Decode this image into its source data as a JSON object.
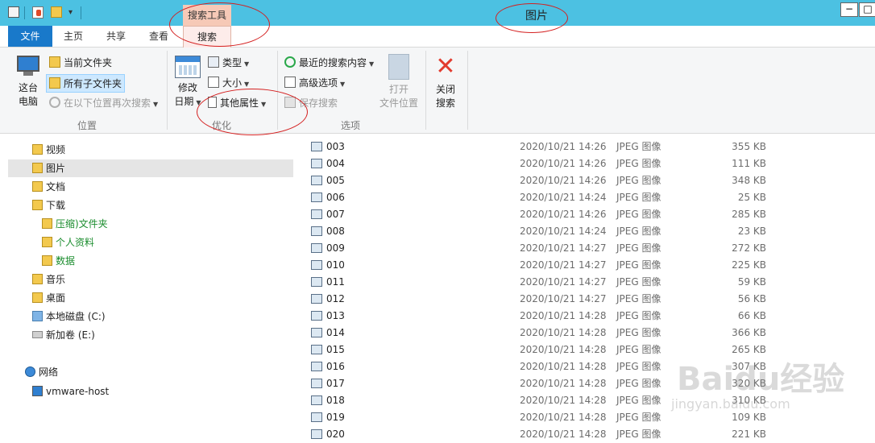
{
  "window": {
    "title": "图片",
    "minimize": "−",
    "maximize": "□"
  },
  "context_tab": {
    "header": "搜索工具",
    "tab": "搜索"
  },
  "tabs": [
    {
      "label": "文件"
    },
    {
      "label": "主页"
    },
    {
      "label": "共享"
    },
    {
      "label": "查看"
    }
  ],
  "ribbon": {
    "location": {
      "group_label": "位置",
      "this_pc_line1": "这台",
      "this_pc_line2": "电脑",
      "current_folder": "当前文件夹",
      "all_subfolders": "所有子文件夹",
      "search_again": "在以下位置再次搜索"
    },
    "refine": {
      "group_label": "优化",
      "date_modified_line1": "修改",
      "date_modified_line2": "日期",
      "kind": "类型",
      "size": "大小",
      "other_properties": "其他属性"
    },
    "options": {
      "group_label": "选项",
      "recent_searches": "最近的搜索内容",
      "advanced_options": "高级选项",
      "save_search": "保存搜索",
      "open_location_line1": "打开",
      "open_location_line2": "文件位置"
    },
    "close": {
      "line1": "关闭",
      "line2": "搜索"
    }
  },
  "nav": {
    "items": [
      {
        "label": "视频"
      },
      {
        "label": "图片"
      },
      {
        "label": "文档"
      },
      {
        "label": "下载"
      },
      {
        "label": "压缩)文件夹"
      },
      {
        "label": "个人资料"
      },
      {
        "label": "数据"
      },
      {
        "label": "音乐"
      },
      {
        "label": "桌面"
      },
      {
        "label": "本地磁盘 (C:)"
      },
      {
        "label": "新加卷 (E:)"
      },
      {
        "label": "网络"
      },
      {
        "label": "vmware-host"
      }
    ]
  },
  "files": [
    {
      "name": "003",
      "date": "2020/10/21 14:26",
      "type": "JPEG 图像",
      "size": "355 KB"
    },
    {
      "name": "004",
      "date": "2020/10/21 14:26",
      "type": "JPEG 图像",
      "size": "111 KB"
    },
    {
      "name": "005",
      "date": "2020/10/21 14:26",
      "type": "JPEG 图像",
      "size": "348 KB"
    },
    {
      "name": "006",
      "date": "2020/10/21 14:24",
      "type": "JPEG 图像",
      "size": "25 KB"
    },
    {
      "name": "007",
      "date": "2020/10/21 14:26",
      "type": "JPEG 图像",
      "size": "285 KB"
    },
    {
      "name": "008",
      "date": "2020/10/21 14:24",
      "type": "JPEG 图像",
      "size": "23 KB"
    },
    {
      "name": "009",
      "date": "2020/10/21 14:27",
      "type": "JPEG 图像",
      "size": "272 KB"
    },
    {
      "name": "010",
      "date": "2020/10/21 14:27",
      "type": "JPEG 图像",
      "size": "225 KB"
    },
    {
      "name": "011",
      "date": "2020/10/21 14:27",
      "type": "JPEG 图像",
      "size": "59 KB"
    },
    {
      "name": "012",
      "date": "2020/10/21 14:27",
      "type": "JPEG 图像",
      "size": "56 KB"
    },
    {
      "name": "013",
      "date": "2020/10/21 14:28",
      "type": "JPEG 图像",
      "size": "66 KB"
    },
    {
      "name": "014",
      "date": "2020/10/21 14:28",
      "type": "JPEG 图像",
      "size": "366 KB"
    },
    {
      "name": "015",
      "date": "2020/10/21 14:28",
      "type": "JPEG 图像",
      "size": "265 KB"
    },
    {
      "name": "016",
      "date": "2020/10/21 14:28",
      "type": "JPEG 图像",
      "size": "307 KB"
    },
    {
      "name": "017",
      "date": "2020/10/21 14:28",
      "type": "JPEG 图像",
      "size": "320 KB"
    },
    {
      "name": "018",
      "date": "2020/10/21 14:28",
      "type": "JPEG 图像",
      "size": "310 KB"
    },
    {
      "name": "019",
      "date": "2020/10/21 14:28",
      "type": "JPEG 图像",
      "size": "109 KB"
    },
    {
      "name": "020",
      "date": "2020/10/21 14:28",
      "type": "JPEG 图像",
      "size": "221 KB"
    }
  ],
  "watermark": {
    "brand": "Baidu经验",
    "url": "jingyan.baidu.com"
  },
  "colors": {
    "titlebar": "#4cc1e2",
    "file_tab": "#1979ca",
    "context_tab": "#f6c9b7",
    "annotation": "#d42020"
  }
}
